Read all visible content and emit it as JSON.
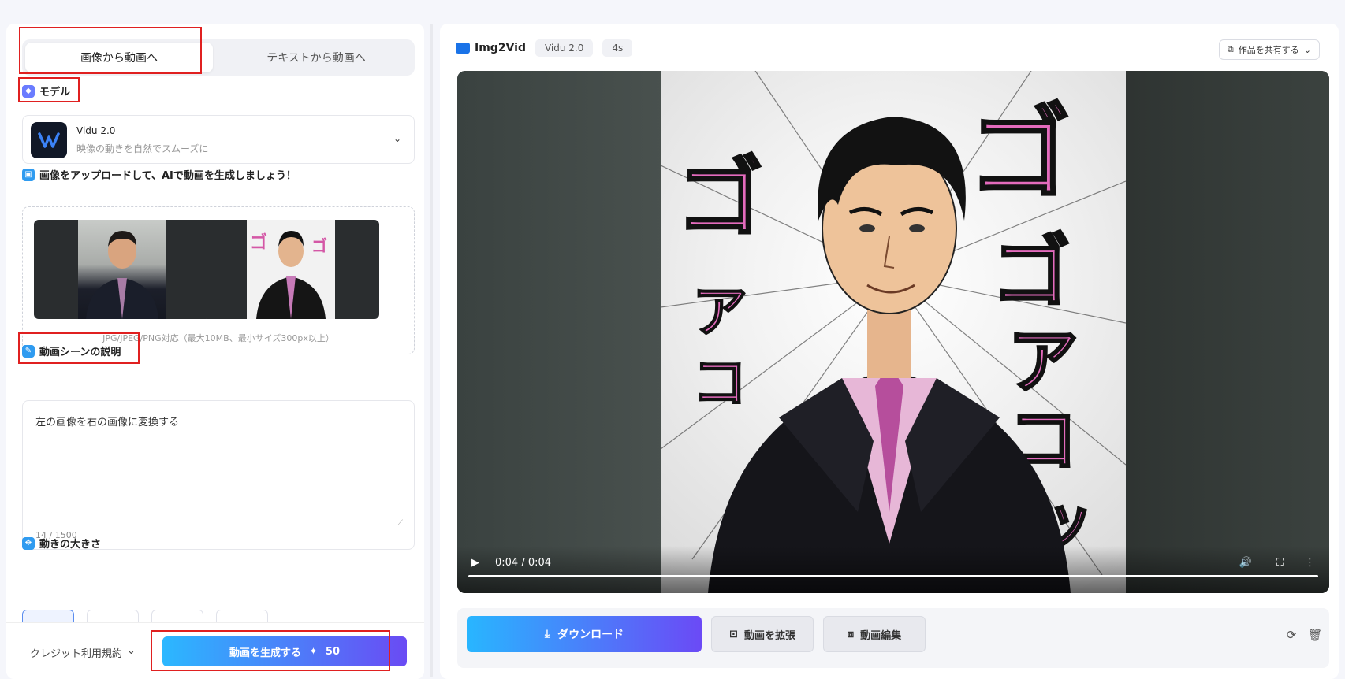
{
  "tabs": [
    "画像から動画へ",
    "テキストから動画へ"
  ],
  "model": {
    "section_title": "モデル",
    "name": "Vidu 2.0",
    "description": "映像の動きを自然でスムーズに"
  },
  "upload": {
    "section_title": "画像をアップロードして、AIで動画を生成しましょう！",
    "hint": "JPG/JPEG/PNG対応（最大10MB、最小サイズ300px以上）"
  },
  "scene": {
    "section_title": "動画シーンの説明",
    "text": "左の画像を右の画像に変換する",
    "counter": "14 / 1500"
  },
  "motion": {
    "section_title": "動きの大きさ"
  },
  "bottom": {
    "credit_label": "クレジット利用規約",
    "generate_label": "動画を生成する",
    "generate_cost": "50"
  },
  "preview": {
    "title": "Img2Vid",
    "chips": [
      "Vidu 2.0",
      "4s"
    ],
    "share_label": "作品を共有する",
    "time": "0:04 / 0:04"
  },
  "actions": {
    "download": "ダウンロード",
    "extend": "動画を拡張",
    "edit": "動画編集"
  },
  "colors": {
    "accent_start": "#2bb8ff",
    "accent_end": "#6a4bf4",
    "highlight_box": "#e02020"
  }
}
